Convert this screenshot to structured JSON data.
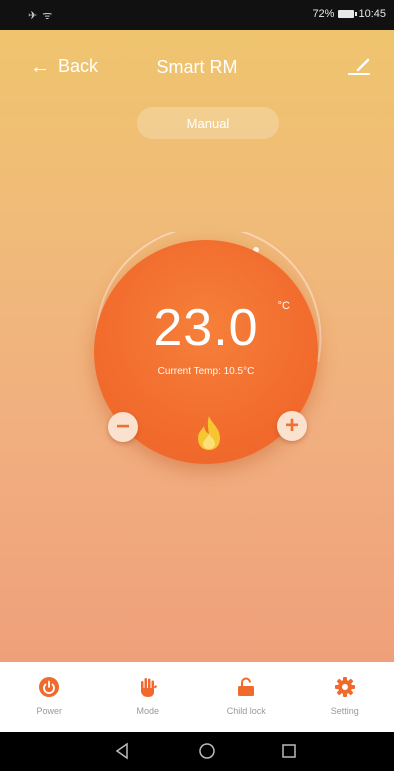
{
  "status_bar": {
    "left_icons": "✈ ᯤ",
    "right_text": "72%",
    "time": "10:45"
  },
  "app_bar": {
    "back_label": "Back",
    "title": "Smart RM",
    "edit_icon": "edit-icon"
  },
  "mode_pill": {
    "label": "Manual"
  },
  "dial": {
    "set_temperature": "23.0",
    "unit": "°C",
    "current_temperature_text": "Current Temp: 10.5°C",
    "minus_label": "−",
    "plus_label": "+",
    "status_icon": "flame-icon"
  },
  "bottom_nav": {
    "items": [
      {
        "label": "Power",
        "icon": "power-icon"
      },
      {
        "label": "Mode",
        "icon": "hand-icon"
      },
      {
        "label": "Child lock",
        "icon": "unlock-icon"
      },
      {
        "label": "Setting",
        "icon": "gear-icon"
      }
    ]
  },
  "colors": {
    "accent": "#f26d2e",
    "gradient_top": "#efc46e",
    "gradient_bottom": "#efa07a",
    "flame": "#f7c531"
  }
}
